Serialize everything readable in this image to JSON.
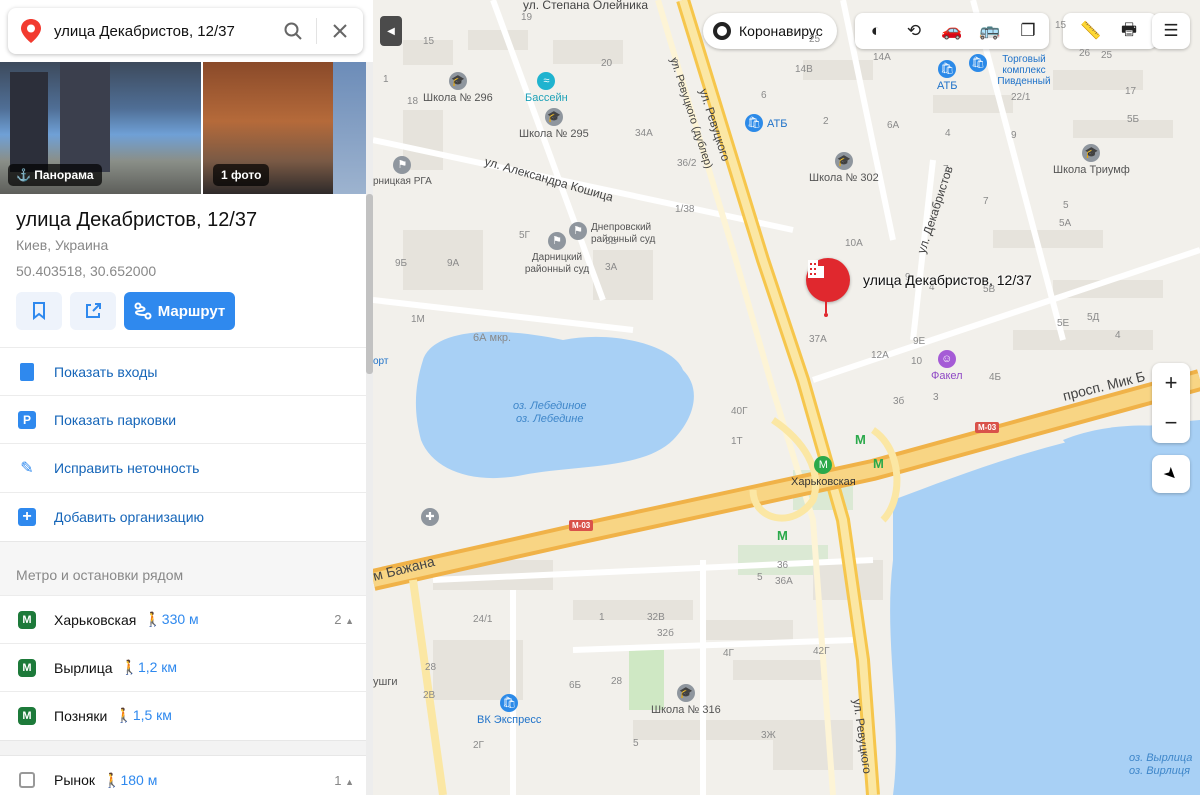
{
  "search": {
    "value": "улица Декабристов, 12/37"
  },
  "photos": {
    "panorama_label": "Панорама",
    "photo_label": "1 фото"
  },
  "place": {
    "title": "улица Декабристов, 12/37",
    "subtitle": "Киев, Украина",
    "coords": "50.403518, 30.652000",
    "route_label": "Маршрут"
  },
  "actions": [
    {
      "label": "Показать входы",
      "icon": "entrances-icon",
      "color": "#2f89ee"
    },
    {
      "label": "Показать парковки",
      "icon": "parking-icon",
      "color": "#2f89ee"
    },
    {
      "label": "Исправить неточность",
      "icon": "pencil-icon",
      "color": "#2f89ee"
    },
    {
      "label": "Добавить организацию",
      "icon": "plus-icon",
      "color": "#2f89ee"
    }
  ],
  "nearby": {
    "heading": "Метро и остановки рядом",
    "stops": [
      {
        "name": "Харьковская",
        "walk": "330 м",
        "count": "2",
        "type": "metro",
        "icon": "metro-icon"
      },
      {
        "name": "Вырлица",
        "walk": "1,2 км",
        "count": "",
        "type": "metro",
        "icon": "metro-icon"
      },
      {
        "name": "Позняки",
        "walk": "1,5 км",
        "count": "",
        "type": "metro",
        "icon": "metro-icon"
      },
      {
        "name": "Рынок",
        "walk": "180 м",
        "count": "1",
        "type": "bus",
        "icon": "bus-stop-icon"
      }
    ]
  },
  "map": {
    "coronavirus_label": "Коронавирус",
    "marker_label": "улица Декабристов, 12/37",
    "layers": [
      "traffic-icon",
      "panorama-layer-icon",
      "carsharing-icon",
      "transit-icon",
      "layers-icon"
    ],
    "tools": [
      "ruler-icon",
      "print-icon",
      "menu-icon"
    ],
    "zoom_in": "+",
    "zoom_out": "−",
    "streets": {
      "stepan": "ул. Степана Олейника",
      "revutskogo_dubler": "ул. Ревуцкого (дублер)",
      "revutskogo": "ул. Ревуцкого",
      "koshitsa": "ул. Александра Кошица",
      "dekabristov": "ул. Декабристов",
      "mikoly": "просп. Мик Б",
      "bazhana": "м Бажана",
      "revutskogo_s": "ул. Ревуцкого",
      "vyrlitsa": "оз. Вырлица",
      "vyrlitsa_ua": "оз. Вирлиця",
      "lebedinoe": "оз. Лебединое",
      "lebedine": "оз. Лебедине",
      "microdistrict": "6А мкр.",
      "highway": "M-03"
    },
    "pois": {
      "school296": "Школа № 296",
      "pool": "Бассейн",
      "school295": "Школа № 295",
      "atb1": "АТБ",
      "atb2": "АТБ",
      "school302": "Школа № 302",
      "triumph": "Школа Триумф",
      "torg": "Торговый комплекс Пивденный",
      "dnepr_court": "Днепровский районный суд",
      "darn_court": "Дарницкий районный суд",
      "rga": "рницкая РГА",
      "fakel": "Факел",
      "kharkovskaya": "Харьковская",
      "school316": "Школа № 316",
      "vk": "ВК Экспресс",
      "port": "орт",
      "ushgi": "ушги"
    },
    "numbers": [
      "19",
      "15",
      "20",
      "25",
      "14В",
      "14А",
      "15",
      "26",
      "25",
      "22/1",
      "17",
      "1",
      "18",
      "3",
      "6",
      "6А",
      "2",
      "4",
      "9",
      "5",
      "5А",
      "5Б",
      "7",
      "7",
      "36/2",
      "34А",
      "1/38",
      "5Г",
      "9Б",
      "9А",
      "3Б",
      "3А",
      "10А",
      "9",
      "4",
      "5В",
      "1М",
      "37А",
      "12А",
      "9Е",
      "10",
      "5Е",
      "5Д",
      "4",
      "4Б",
      "3б",
      "3",
      "40Г",
      "1Т",
      "5",
      "36",
      "36А",
      "24/1",
      "1",
      "32В",
      "32б",
      "42Г",
      "28",
      "28",
      "6Б",
      "2В",
      "4Г",
      "2Г",
      "5",
      "3Ж"
    ]
  }
}
